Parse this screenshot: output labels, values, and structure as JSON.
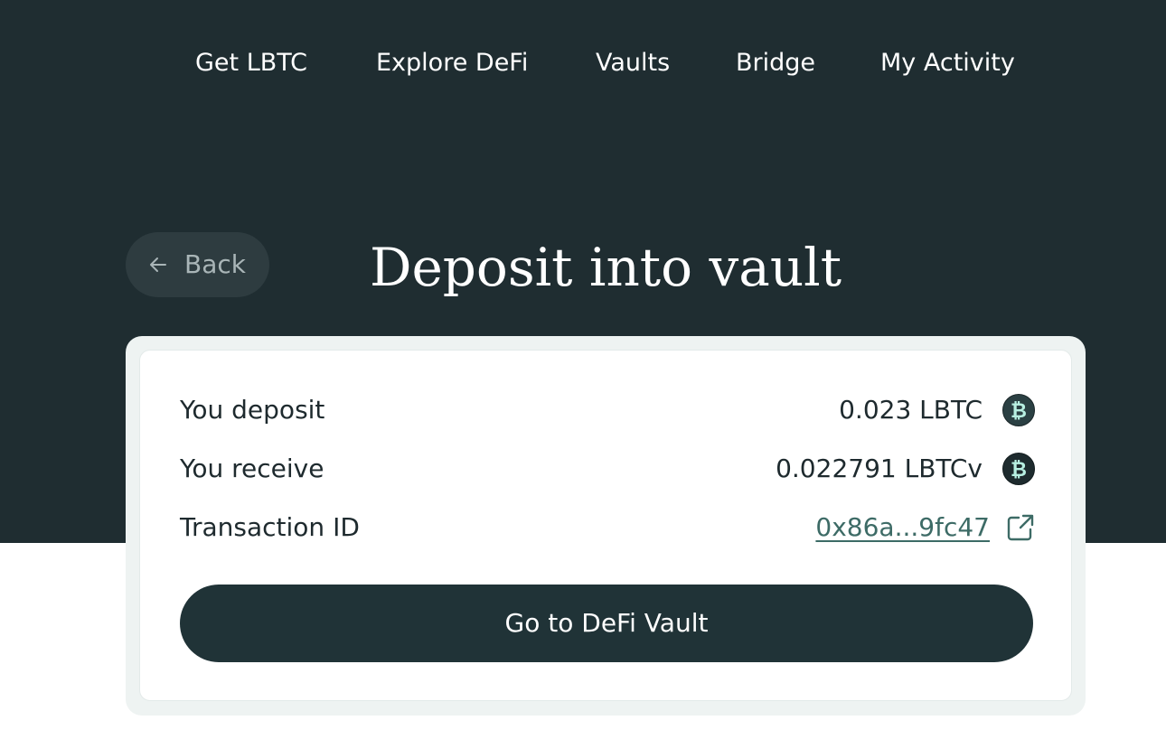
{
  "nav": {
    "items": [
      {
        "label": "Get LBTC"
      },
      {
        "label": "Explore DeFi"
      },
      {
        "label": "Vaults"
      },
      {
        "label": "Bridge"
      },
      {
        "label": "My Activity"
      }
    ]
  },
  "back_button": {
    "label": "Back",
    "icon": "arrow-left-icon"
  },
  "page": {
    "title": "Deposit into vault"
  },
  "summary": {
    "deposit": {
      "label": "You deposit",
      "value": "0.023 LBTC",
      "icon": "bitcoin-icon"
    },
    "receive": {
      "label": "You receive",
      "value": "0.022791 LBTCv",
      "icon": "bitcoin-icon"
    },
    "transaction": {
      "label": "Transaction ID",
      "value": "0x86a...9fc47",
      "icon": "external-link-icon"
    }
  },
  "cta": {
    "label": "Go to DeFi Vault"
  },
  "colors": {
    "hero_bg": "#1f2d31",
    "card_bg": "#eef3f2",
    "button_bg": "#203337",
    "link": "#3d6b66",
    "coin_bg": "#2b4043",
    "coin_symbol": "#b8f0e2"
  }
}
